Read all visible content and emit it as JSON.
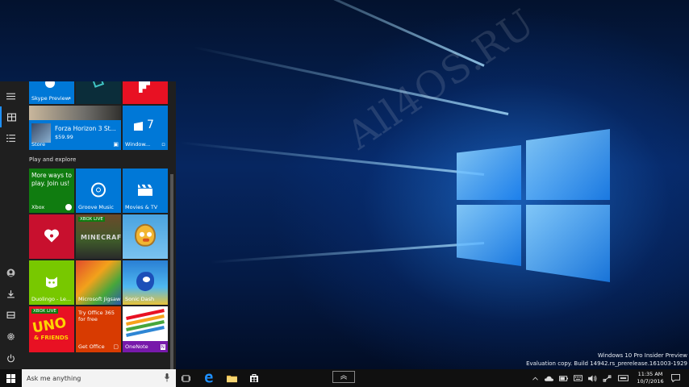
{
  "colors": {
    "accent": "#1e90ff",
    "xbox_green": "#107c10",
    "tile_blue": "#0078d7",
    "office_orange": "#d83b01",
    "red": "#e81123"
  },
  "desktop": {
    "watermark": "All4OS.RU",
    "eval_line1": "Windows 10 Pro Insider Preview",
    "eval_line2": "Evaluation copy. Build 14942.rs_prerelease.161003-1929"
  },
  "start_menu": {
    "rail_icons": [
      "hamburger-icon",
      "tiles-icon",
      "all-apps-icon",
      "user-icon",
      "downloads-icon",
      "explorer-icon",
      "settings-icon",
      "power-icon"
    ],
    "top_tiles": {
      "skype": "Skype Preview",
      "forza_title": "Forza Horizon 3 St...",
      "forza_price": "$59.99",
      "forza_store": "Store",
      "windows_count": "7",
      "windows_label": "Window..."
    },
    "section_title": "Play and explore",
    "tiles": {
      "xbox_text": "More ways to play. Join us!",
      "xbox_label": "Xbox",
      "groove": "Groove Music",
      "movies": "Movies & TV",
      "xbox_live_1": "XBOX LIVE",
      "minecraft_logo": "MINECRAFT",
      "jigsaw": "Microsoft Jigsaw",
      "duolingo": "Duolingo - Le...",
      "jigsaw2": "Microsoft Jigsaw",
      "sonic": "Sonic Dash",
      "xbox_live_2": "XBOX LIVE",
      "uno_logo": "UNO",
      "uno_sub": "& FRIENDS",
      "office_text": "Try Office 365 for free",
      "get_office": "Get Office",
      "onenote": "OneNote"
    }
  },
  "taskbar": {
    "search_placeholder": "Ask me anything",
    "time": "11:35 AM",
    "date": "10/7/2016"
  }
}
